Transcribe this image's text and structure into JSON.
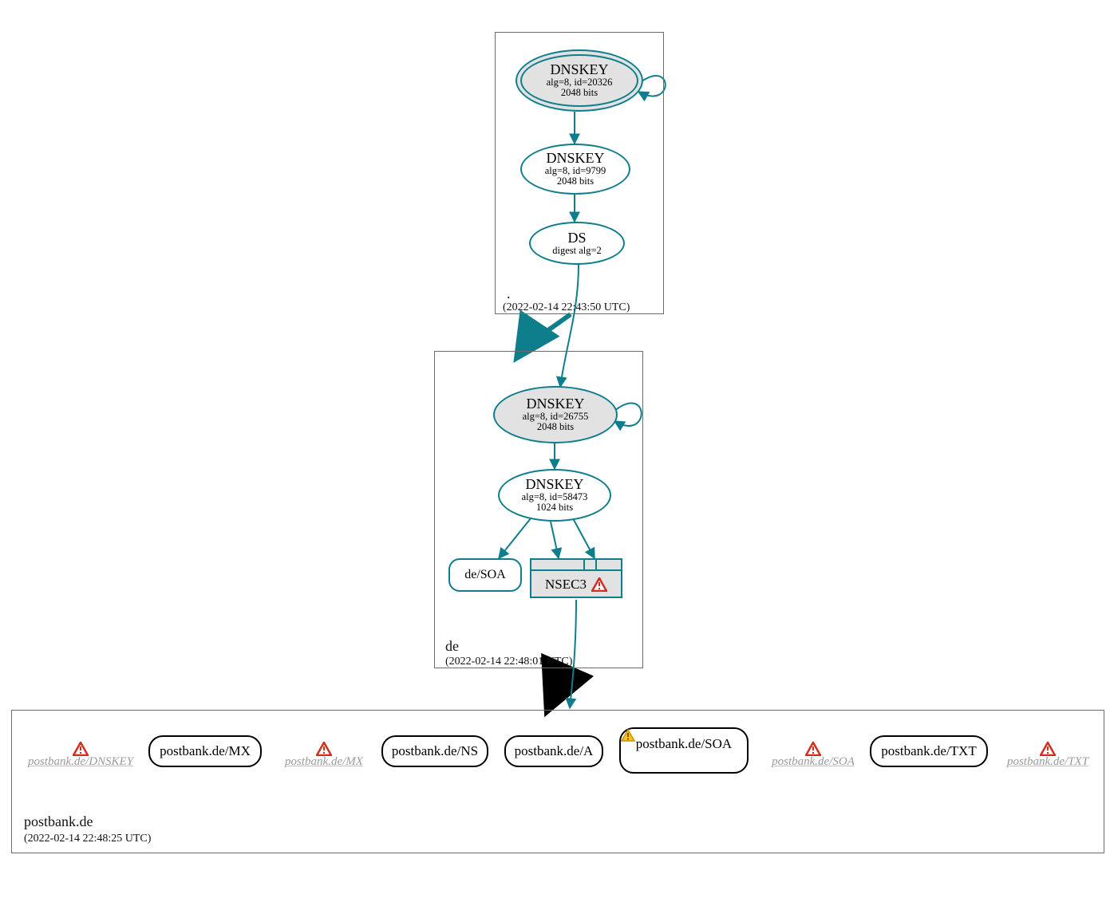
{
  "zones": {
    "root": {
      "label": ".",
      "timestamp": "(2022-02-14 22:43:50 UTC)"
    },
    "de": {
      "label": "de",
      "timestamp": "(2022-02-14 22:48:01 UTC)"
    },
    "postbank": {
      "label": "postbank.de",
      "timestamp": "(2022-02-14 22:48:25 UTC)"
    }
  },
  "root": {
    "key1": {
      "title": "DNSKEY",
      "sub1": "alg=8, id=20326",
      "sub2": "2048 bits"
    },
    "key2": {
      "title": "DNSKEY",
      "sub1": "alg=8, id=9799",
      "sub2": "2048 bits"
    },
    "ds": {
      "title": "DS",
      "sub1": "digest alg=2"
    }
  },
  "de": {
    "key1": {
      "title": "DNSKEY",
      "sub1": "alg=8, id=26755",
      "sub2": "2048 bits"
    },
    "key2": {
      "title": "DNSKEY",
      "sub1": "alg=8, id=58473",
      "sub2": "1024 bits"
    },
    "soa": "de/SOA",
    "nsec3": "NSEC3"
  },
  "postbank": {
    "ghosts": {
      "dnskey": "postbank.de/DNSKEY",
      "mx": "postbank.de/MX",
      "soa": "postbank.de/SOA",
      "txt": "postbank.de/TXT"
    },
    "nodes": {
      "mx": "postbank.de/MX",
      "ns": "postbank.de/NS",
      "a": "postbank.de/A",
      "soa": "postbank.de/SOA",
      "txt": "postbank.de/TXT"
    }
  },
  "colors": {
    "teal": "#0e7e8d",
    "red": "#d42d20",
    "yellow": "#f2c200"
  }
}
